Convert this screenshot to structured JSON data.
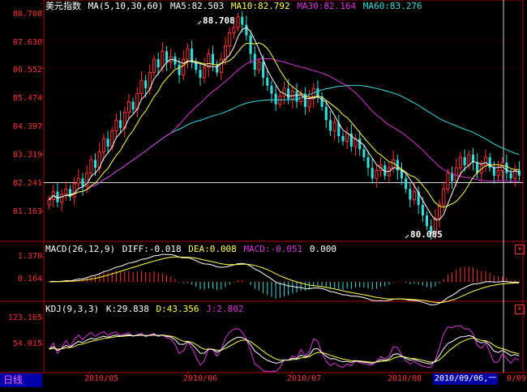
{
  "main_panel": {
    "title": "美元指数",
    "ma_header": "MA(5,10,30,60)",
    "ma5": "MA5:82.503",
    "ma10": "MA10:82.792",
    "ma30": "MA30:82.164",
    "ma60": "MA60:83.276",
    "high_label": "88.708",
    "low_label": "80.085",
    "y_ticks": [
      "88.708",
      "87.630",
      "86.552",
      "85.474",
      "84.397",
      "83.319",
      "82.241",
      "81.163"
    ]
  },
  "macd_panel": {
    "header": "MACD(26,12,9)",
    "diff": "DIFF:-0.018",
    "dea": "DEA:0.008",
    "macd": "MACD:-0.051",
    "extra": "0.000",
    "y_ticks": [
      "1.370",
      "0.164"
    ]
  },
  "kdj_panel": {
    "header": "KDJ(9,3,3)",
    "k": "K:29.838",
    "d": "D:43.356",
    "j": "J:2.802",
    "y_ticks": [
      "123.165",
      "54.015"
    ]
  },
  "x_axis": {
    "labels": [
      "2010/05",
      "2010/06",
      "2010/07",
      "2010/08"
    ],
    "cursor_date": "2010/09/06,一",
    "right_edge_label": "0/09"
  },
  "bottom_tab": {
    "label": "日线"
  },
  "colors": {
    "background": "#000000",
    "up": "#ff3333",
    "down": "#33dddd",
    "ma5": "#ffffff",
    "ma10": "#ffff44",
    "ma30": "#dd33dd",
    "ma60": "#33dddd",
    "axis": "#b00000"
  },
  "chart_data": {
    "type": "candlestick",
    "ylim": [
      80.085,
      88.708
    ],
    "closes": [
      81.6,
      81.9,
      81.5,
      81.8,
      82.0,
      81.7,
      82.2,
      82.4,
      82.1,
      82.6,
      83.1,
      82.8,
      83.4,
      83.9,
      83.6,
      84.2,
      84.6,
      84.3,
      84.9,
      85.3,
      85.0,
      85.6,
      86.1,
      85.8,
      86.4,
      86.9,
      86.6,
      87.2,
      86.8,
      87.0,
      86.7,
      86.3,
      86.9,
      87.3,
      86.8,
      86.5,
      86.2,
      86.6,
      87.1,
      86.7,
      86.4,
      86.9,
      87.4,
      87.9,
      88.1,
      88.5,
      88.2,
      87.8,
      87.1,
      86.5,
      86.8,
      86.2,
      85.9,
      85.6,
      85.2,
      85.5,
      85.8,
      85.4,
      85.7,
      85.3,
      85.6,
      85.1,
      85.4,
      85.8,
      85.5,
      85.1,
      84.6,
      84.2,
      84.5,
      84.0,
      83.8,
      84.1,
      83.6,
      83.9,
      83.5,
      83.2,
      82.8,
      82.4,
      82.7,
      82.9,
      82.5,
      82.8,
      83.1,
      82.7,
      82.4,
      82.0,
      81.6,
      81.9,
      81.4,
      81.0,
      80.6,
      80.3,
      80.9,
      81.4,
      82.0,
      82.6,
      82.3,
      82.8,
      83.2,
      82.9,
      83.3,
      83.0,
      82.6,
      82.9,
      83.2,
      82.8,
      82.5,
      82.7,
      83.0,
      82.6,
      82.4,
      82.7,
      82.5
    ]
  }
}
